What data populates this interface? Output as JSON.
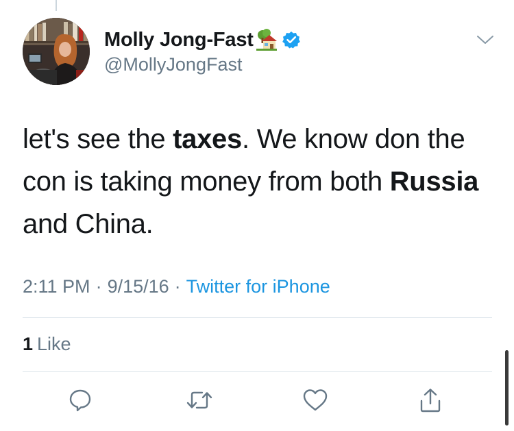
{
  "tweet": {
    "author": {
      "display_name": "Molly Jong-Fast",
      "handle": "@MollyJongFast",
      "name_emoji": "house-with-garden-icon",
      "verified": true
    },
    "text_segments": [
      {
        "text": "let's see the ",
        "bold": false
      },
      {
        "text": "taxes",
        "bold": true
      },
      {
        "text": ".  We know don the con is taking money from both ",
        "bold": false
      },
      {
        "text": "Russia",
        "bold": true
      },
      {
        "text": " and China.",
        "bold": false
      }
    ],
    "time": "2:11 PM",
    "date": "9/15/16",
    "separator": "·",
    "source": "Twitter for iPhone",
    "likes_count": "1",
    "likes_label": "Like"
  },
  "actions": [
    {
      "name": "reply-icon"
    },
    {
      "name": "retweet-icon"
    },
    {
      "name": "like-icon"
    },
    {
      "name": "share-icon"
    }
  ],
  "colors": {
    "text": "#14171a",
    "secondary": "#657786",
    "link": "#1b95e0",
    "verified": "#1da1f2",
    "divider": "#e1e8ed"
  }
}
